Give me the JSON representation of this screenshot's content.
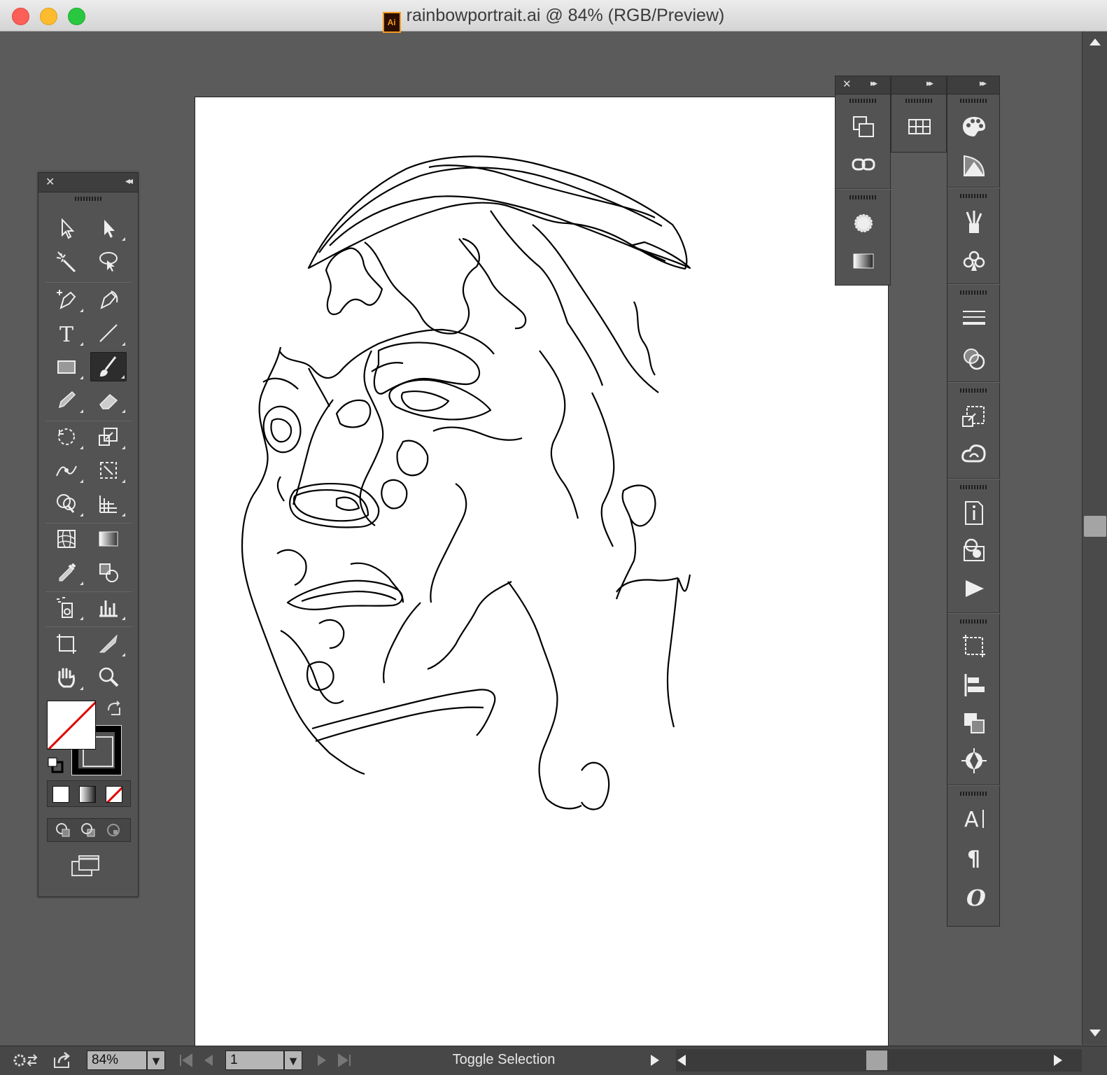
{
  "window": {
    "title": "rainbowportrait.ai @ 84% (RGB/Preview)",
    "doc_icon_label": "Ai"
  },
  "tools_panel": {
    "close": "✕",
    "collapse": "◂◂"
  },
  "dock": {
    "close": "✕",
    "expand": "▸▸"
  },
  "status_bar": {
    "zoom": "84%",
    "artboard_number": "1",
    "status_text": "Toggle Selection"
  },
  "colors": {
    "window_bg": "#5b5b5b",
    "panel_bg": "#535353",
    "panel_header": "#3e3e3e",
    "artboard": "#ffffff",
    "no_fill_slash": "#e10000"
  }
}
